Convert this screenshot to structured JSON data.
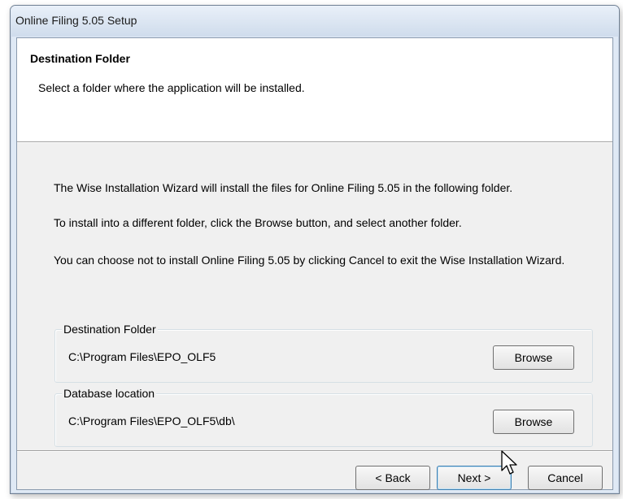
{
  "window": {
    "title": "Online Filing 5.05 Setup"
  },
  "header": {
    "title": "Destination Folder",
    "subtitle": "Select a folder where the application will be installed."
  },
  "body": {
    "paragraph1": "The Wise Installation Wizard will install the files for Online Filing 5.05 in the following folder.",
    "paragraph2": "To install into a different folder, click the Browse button, and select another folder.",
    "paragraph3": "You can choose not to install Online Filing 5.05 by clicking Cancel to exit the Wise Installation Wizard."
  },
  "destination_group": {
    "label": "Destination Folder",
    "path": "C:\\Program Files\\EPO_OLF5",
    "browse_label": "Browse"
  },
  "database_group": {
    "label": "Database location",
    "path": "C:\\Program Files\\EPO_OLF5\\db\\",
    "browse_label": "Browse"
  },
  "footer": {
    "back_label": "< Back",
    "next_label": "Next >",
    "cancel_label": "Cancel"
  },
  "icons": {
    "cursor": "arrow-cursor-icon"
  }
}
